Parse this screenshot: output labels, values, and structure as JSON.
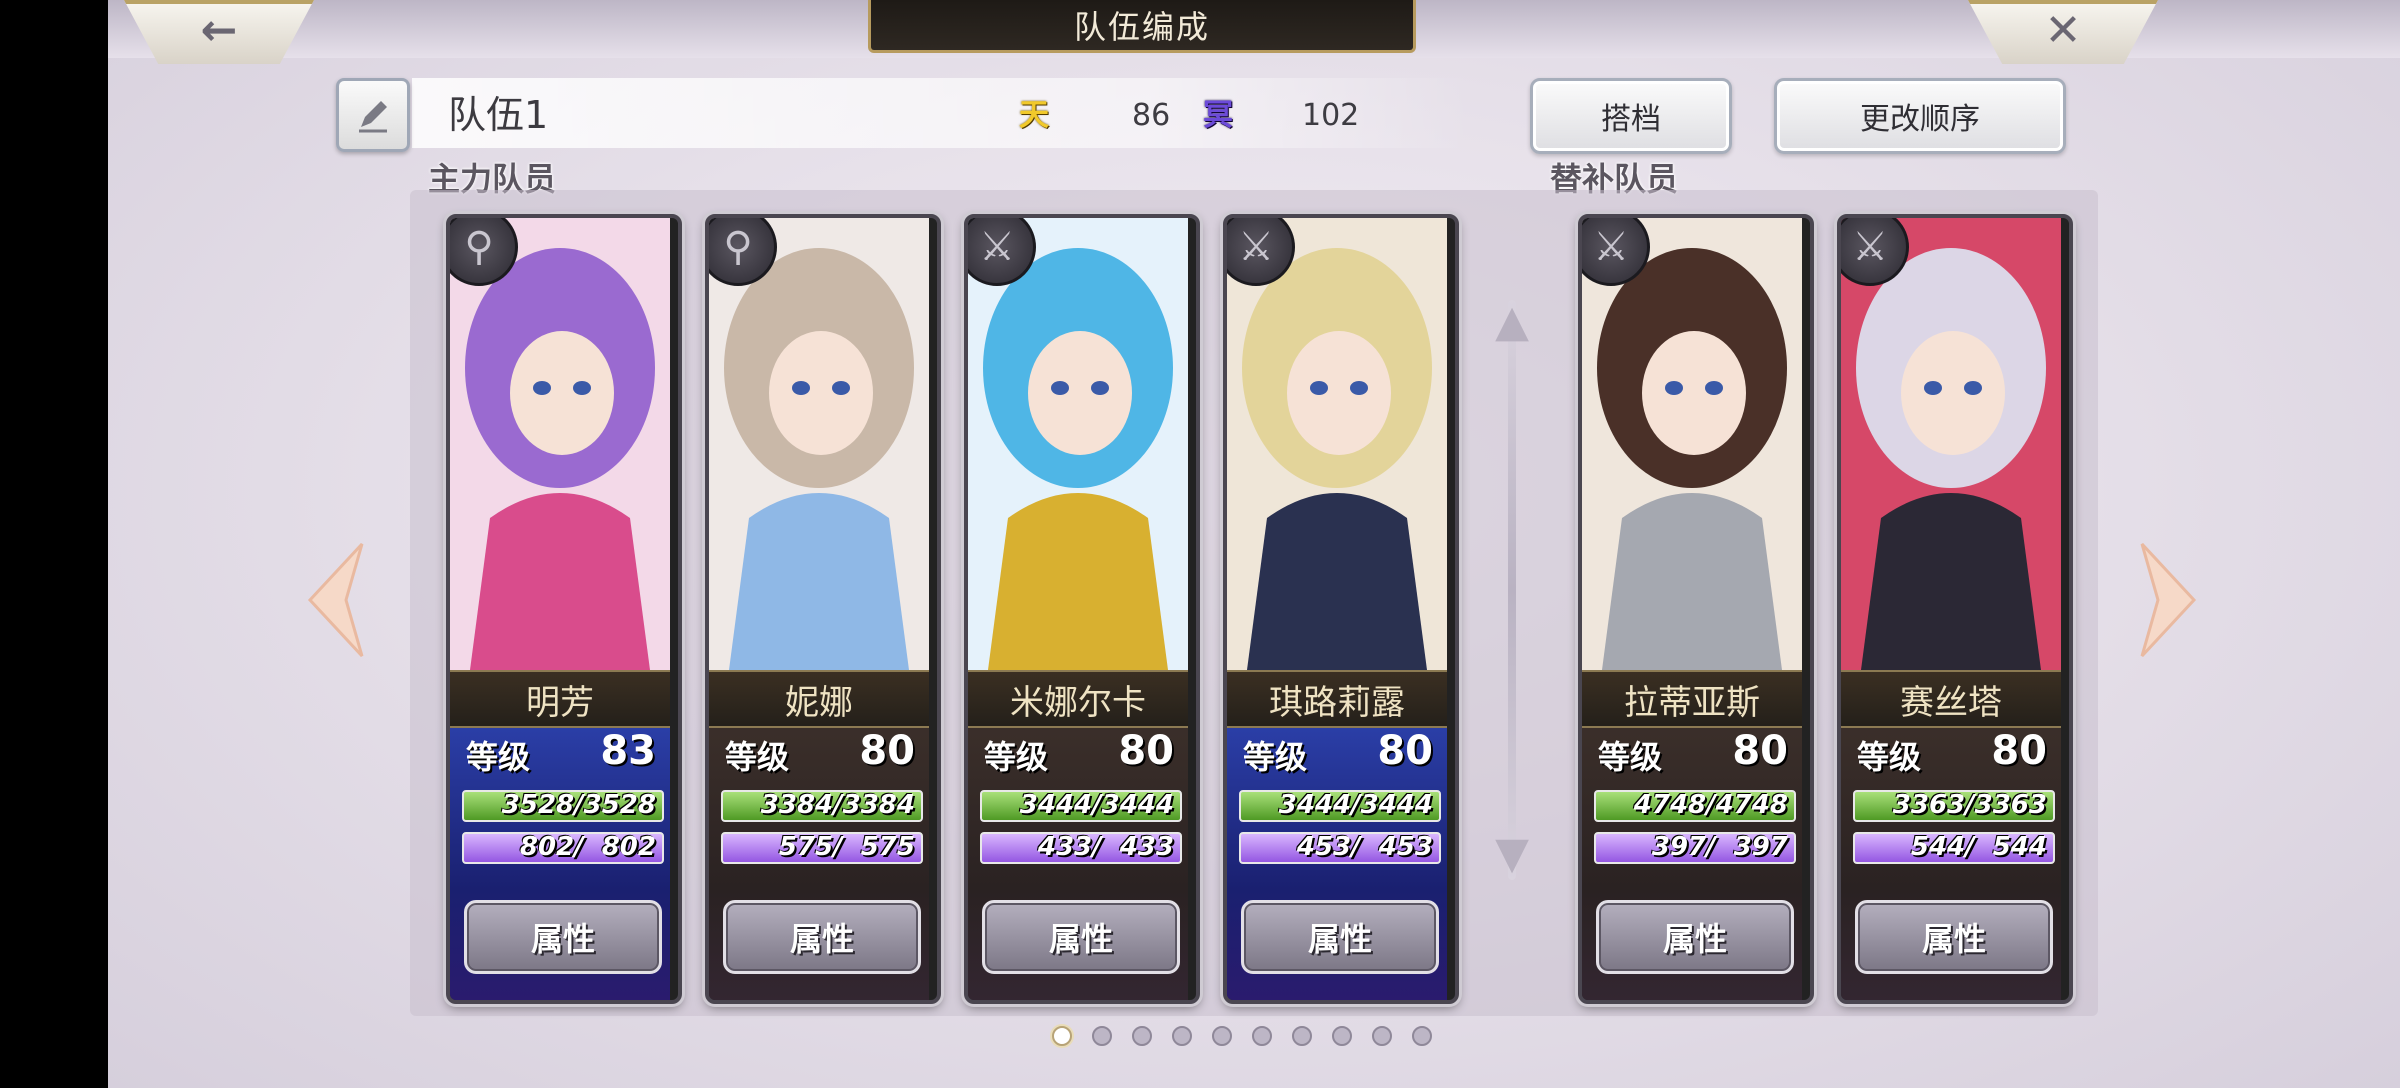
{
  "header": {
    "title": "队伍编成",
    "back_icon": "left-arrow-icon",
    "close_icon": "close-icon"
  },
  "team": {
    "name": "队伍1",
    "heaven_icon": "天",
    "heaven_value": "86",
    "dark_icon": "冥",
    "dark_value": "102"
  },
  "buttons": {
    "partner": "搭档",
    "reorder": "更改顺序",
    "attribute": "属性"
  },
  "sections": {
    "main": "主力队员",
    "sub": "替补队员"
  },
  "stat_labels": {
    "level": "等级"
  },
  "members": [
    {
      "name": "明芳",
      "level": "83",
      "hp": "3528/3528",
      "mp": " 802/  802",
      "weapon": "staff-icon",
      "theme": "blue",
      "palette": [
        "#f3d9e8",
        "#9a6ad0",
        "#d94c8c"
      ]
    },
    {
      "name": "妮娜",
      "level": "80",
      "hp": "3384/3384",
      "mp": " 575/  575",
      "weapon": "staff-icon",
      "theme": "brown",
      "palette": [
        "#efe9e6",
        "#c9b8a8",
        "#8fb8e6"
      ]
    },
    {
      "name": "米娜尔卡",
      "level": "80",
      "hp": "3444/3444",
      "mp": " 433/  433",
      "weapon": "sword-icon",
      "theme": "brown",
      "palette": [
        "#e5f2fb",
        "#4fb6e6",
        "#d8b030"
      ]
    },
    {
      "name": "琪路莉露",
      "level": "80",
      "hp": "3444/3444",
      "mp": " 453/  453",
      "weapon": "sword-icon",
      "theme": "blue",
      "palette": [
        "#efe6d8",
        "#e3d49a",
        "#2a3150"
      ]
    }
  ],
  "subs": [
    {
      "name": "拉蒂亚斯",
      "level": "80",
      "hp": "4748/4748",
      "mp": " 397/  397",
      "weapon": "sword-icon",
      "theme": "brown",
      "palette": [
        "#efe6dc",
        "#4a3028",
        "#a5a8b0"
      ]
    },
    {
      "name": "赛丝塔",
      "level": "80",
      "hp": "3363/3363",
      "mp": " 544/  544",
      "weapon": "sword-icon",
      "theme": "brown",
      "palette": [
        "#d64868",
        "#dcd6e6",
        "#2b2835"
      ]
    }
  ],
  "pagination": {
    "total": 10,
    "active": 0
  }
}
